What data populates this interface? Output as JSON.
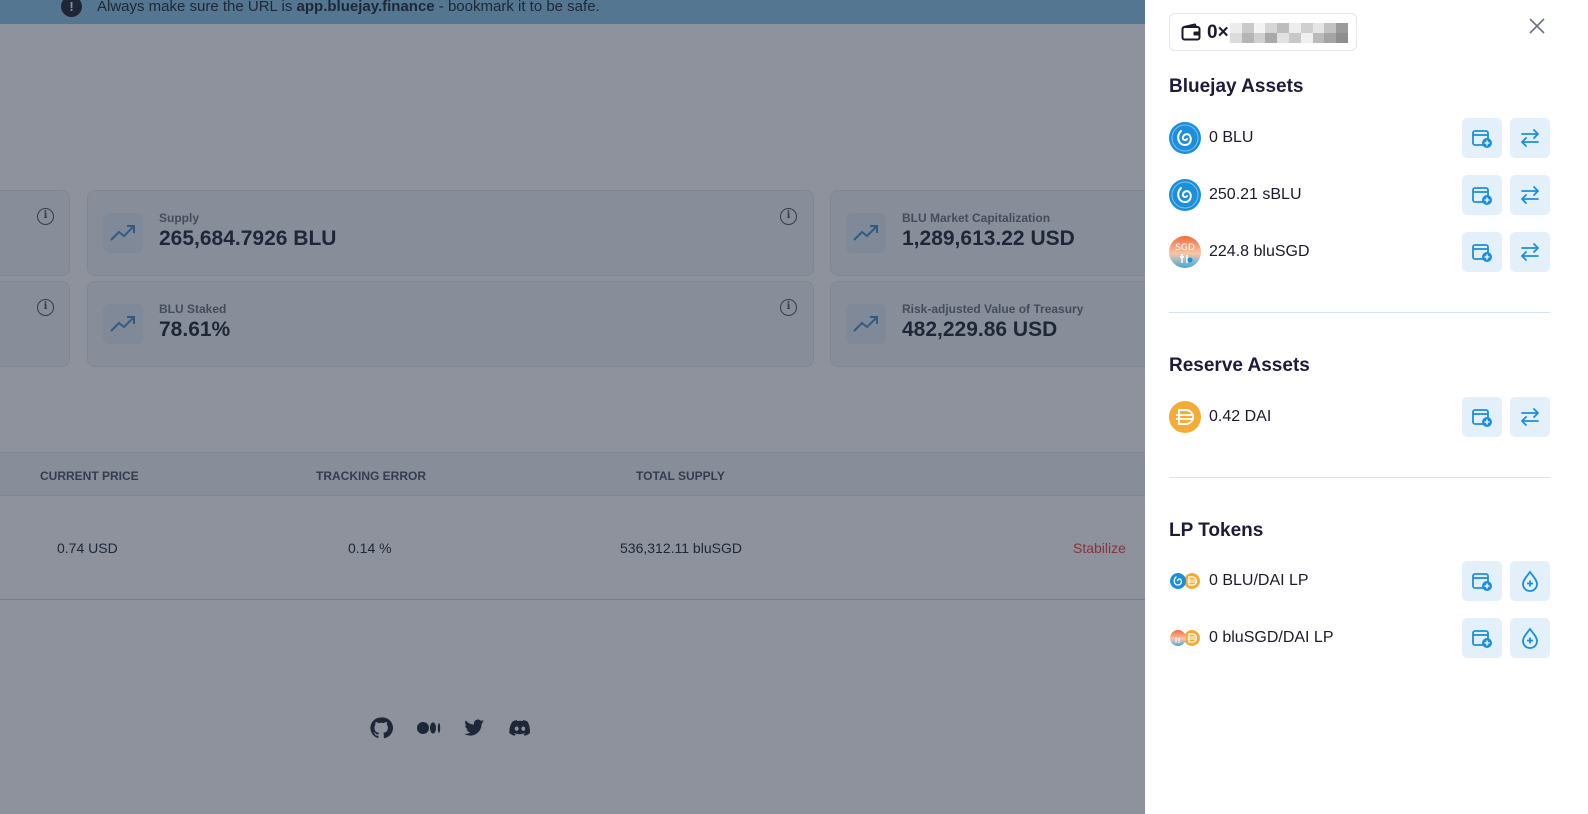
{
  "banner": {
    "prefix": "Always make sure the URL is",
    "url": "app.bluejay.finance",
    "suffix": "- bookmark it to be safe."
  },
  "stats": [
    {
      "label": "Supply",
      "value": "265,684.7926 BLU"
    },
    {
      "label": "BLU Market Capitalization",
      "value": "1,289,613.22 USD"
    },
    {
      "label": "BLU Staked",
      "value": "78.61%"
    },
    {
      "label": "Risk-adjusted Value of Treasury",
      "value": "482,229.86 USD"
    }
  ],
  "table": {
    "headers": [
      "CURRENT PRICE",
      "TRACKING ERROR",
      "TOTAL SUPPLY"
    ],
    "row": {
      "price": "0.74 USD",
      "tracking_error": "0.14 %",
      "total_supply": "536,312.11 bluSGD",
      "action": "Stabilize"
    }
  },
  "footer": {
    "socials": [
      "github-icon",
      "medium-icon",
      "twitter-icon",
      "discord-icon"
    ]
  },
  "drawer": {
    "wallet_prefix": "0×",
    "sections": {
      "bluejay": {
        "title": "Bluejay Assets",
        "items": [
          {
            "amount": "0 BLU",
            "icon": "blu-token-icon"
          },
          {
            "amount": "250.21 sBLU",
            "icon": "sblu-token-icon"
          },
          {
            "amount": "224.8 bluSGD",
            "icon": "blusgd-token-icon",
            "badge": "SGD"
          }
        ]
      },
      "reserve": {
        "title": "Reserve Assets",
        "items": [
          {
            "amount": "0.42 DAI",
            "icon": "dai-token-icon"
          }
        ]
      },
      "lp": {
        "title": "LP Tokens",
        "items": [
          {
            "amount": "0 BLU/DAI LP",
            "icon": "blu-dai-lp-icon"
          },
          {
            "amount": "0 bluSGD/DAI LP",
            "icon": "blusgd-dai-lp-icon"
          }
        ]
      }
    }
  },
  "colors": {
    "accent": "#1c8fdc",
    "button_bg": "#e3f0fa",
    "dai": "#f5ac37",
    "stabilize": "#ef4444"
  }
}
